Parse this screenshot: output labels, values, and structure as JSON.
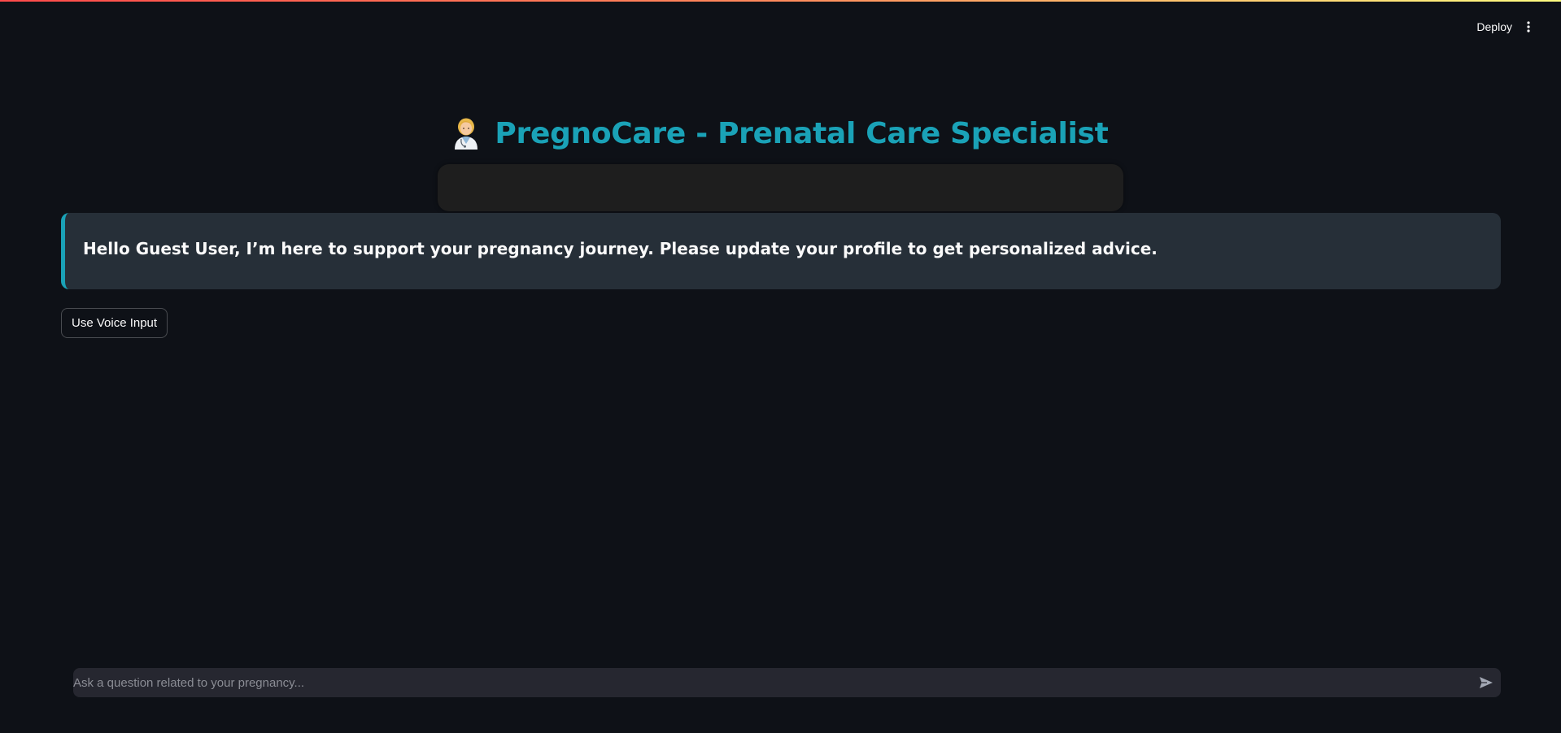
{
  "header": {
    "deploy_label": "Deploy",
    "menu_icon": "vertical-ellipsis-icon"
  },
  "title": {
    "icon": "health-worker-emoji-icon",
    "text": "PregnoCare - Prenatal Care Specialist",
    "color": "#1aa2b7"
  },
  "greeting": {
    "text": "Hello Guest User, I’m here to support your pregnancy journey. Please update your profile to get personalized advice.",
    "accent_color": "#1aa2b7"
  },
  "voice_button": {
    "label": "Use Voice Input"
  },
  "chat": {
    "placeholder": "Ask a question related to your pregnancy...",
    "value": "",
    "send_icon": "send-arrow-icon"
  },
  "colors": {
    "background": "#0e1117",
    "card": "#262f38",
    "input": "#262730"
  }
}
